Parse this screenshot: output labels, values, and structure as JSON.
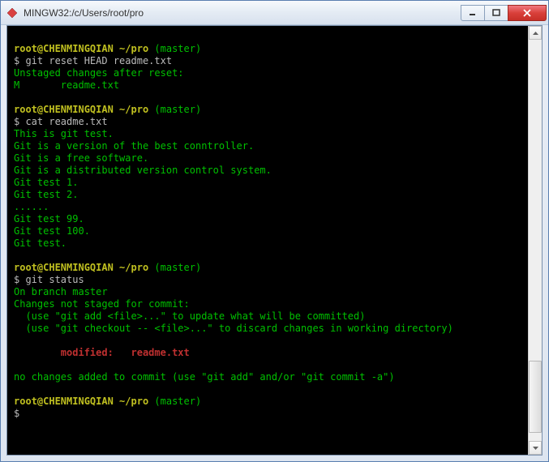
{
  "window": {
    "title": "MINGW32:/c/Users/root/pro"
  },
  "scrollbar": {
    "thumb_top_pct": 80,
    "thumb_height_pct": 18
  },
  "lines": [
    {
      "type": "blank",
      "text": ""
    },
    {
      "type": "prompt",
      "user": "root@CHENMINGQIAN ~/pro ",
      "branch": "(master)"
    },
    {
      "type": "cmd",
      "text": "$ git reset HEAD readme.txt"
    },
    {
      "type": "out",
      "text": "Unstaged changes after reset:"
    },
    {
      "type": "out",
      "text": "M       readme.txt"
    },
    {
      "type": "blank",
      "text": ""
    },
    {
      "type": "prompt",
      "user": "root@CHENMINGQIAN ~/pro ",
      "branch": "(master)"
    },
    {
      "type": "cmd",
      "text": "$ cat readme.txt"
    },
    {
      "type": "out",
      "text": "This is git test."
    },
    {
      "type": "out",
      "text": "Git is a version of the best conntroller."
    },
    {
      "type": "out",
      "text": "Git is a free software."
    },
    {
      "type": "out",
      "text": "Git is a distributed version control system."
    },
    {
      "type": "out",
      "text": "Git test 1."
    },
    {
      "type": "out",
      "text": "Git test 2."
    },
    {
      "type": "out",
      "text": "......"
    },
    {
      "type": "out",
      "text": "Git test 99."
    },
    {
      "type": "out",
      "text": "Git test 100."
    },
    {
      "type": "out",
      "text": "Git test."
    },
    {
      "type": "blank",
      "text": ""
    },
    {
      "type": "prompt",
      "user": "root@CHENMINGQIAN ~/pro ",
      "branch": "(master)"
    },
    {
      "type": "cmd",
      "text": "$ git status"
    },
    {
      "type": "out",
      "text": "On branch master"
    },
    {
      "type": "out",
      "text": "Changes not staged for commit:"
    },
    {
      "type": "out",
      "text": "  (use \"git add <file>...\" to update what will be committed)"
    },
    {
      "type": "out",
      "text": "  (use \"git checkout -- <file>...\" to discard changes in working directory)"
    },
    {
      "type": "blank",
      "text": ""
    },
    {
      "type": "mod",
      "text": "        modified:   readme.txt"
    },
    {
      "type": "blank",
      "text": ""
    },
    {
      "type": "out",
      "text": "no changes added to commit (use \"git add\" and/or \"git commit -a\")"
    },
    {
      "type": "blank",
      "text": ""
    },
    {
      "type": "prompt",
      "user": "root@CHENMINGQIAN ~/pro ",
      "branch": "(master)"
    },
    {
      "type": "cmd",
      "text": "$"
    }
  ]
}
